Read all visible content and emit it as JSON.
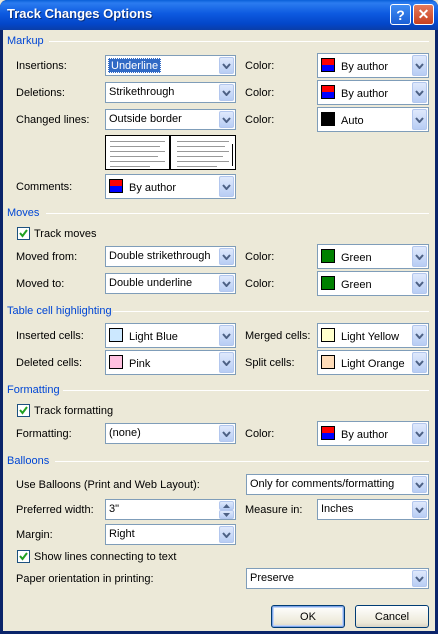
{
  "window": {
    "title": "Track Changes Options",
    "help_glyph": "?",
    "close_glyph": "✕"
  },
  "markup": {
    "heading": "Markup",
    "insertions_label": "Insertions:",
    "insertions_value": "Underline",
    "insertions_color_label": "Color:",
    "insertions_color": "By author",
    "deletions_label": "Deletions:",
    "deletions_value": "Strikethrough",
    "deletions_color_label": "Color:",
    "deletions_color": "By author",
    "changed_lines_label": "Changed lines:",
    "changed_lines_value": "Outside border",
    "changed_lines_color_label": "Color:",
    "changed_lines_color": "Auto",
    "comments_label": "Comments:",
    "comments_color": "By author"
  },
  "moves": {
    "heading": "Moves",
    "track_moves_label": "Track moves",
    "track_moves_checked": true,
    "moved_from_label": "Moved from:",
    "moved_from_value": "Double strikethrough",
    "moved_from_color_label": "Color:",
    "moved_from_color": "Green",
    "moved_to_label": "Moved to:",
    "moved_to_value": "Double underline",
    "moved_to_color_label": "Color:",
    "moved_to_color": "Green"
  },
  "table_cells": {
    "heading": "Table cell highlighting",
    "inserted_label": "Inserted cells:",
    "inserted_color": "Light Blue",
    "merged_label": "Merged cells:",
    "merged_color": "Light Yellow",
    "deleted_label": "Deleted cells:",
    "deleted_color": "Pink",
    "split_label": "Split cells:",
    "split_color": "Light Orange"
  },
  "formatting": {
    "heading": "Formatting",
    "track_formatting_label": "Track formatting",
    "track_formatting_checked": true,
    "formatting_label": "Formatting:",
    "formatting_value": "(none)",
    "color_label": "Color:",
    "color_value": "By author"
  },
  "balloons": {
    "heading": "Balloons",
    "use_balloons_label": "Use Balloons (Print and Web Layout):",
    "use_balloons_value": "Only for comments/formatting",
    "preferred_width_label": "Preferred width:",
    "preferred_width_value": "3\"",
    "measure_in_label": "Measure in:",
    "measure_in_value": "Inches",
    "margin_label": "Margin:",
    "margin_value": "Right",
    "show_lines_label": "Show lines connecting to text",
    "show_lines_checked": true,
    "paper_orientation_label": "Paper orientation in printing:",
    "paper_orientation_value": "Preserve"
  },
  "buttons": {
    "ok": "OK",
    "cancel": "Cancel"
  },
  "colors": {
    "author_top": "#ff0000",
    "author_bottom": "#0000ff",
    "auto": "#000000",
    "green": "#008000",
    "light_blue": "#cce8ff",
    "light_yellow": "#ffffcc",
    "pink": "#ffc0e0",
    "light_orange": "#ffdcb8",
    "section_heading": "#0046d5",
    "title_bar": "#0d5ae0"
  }
}
